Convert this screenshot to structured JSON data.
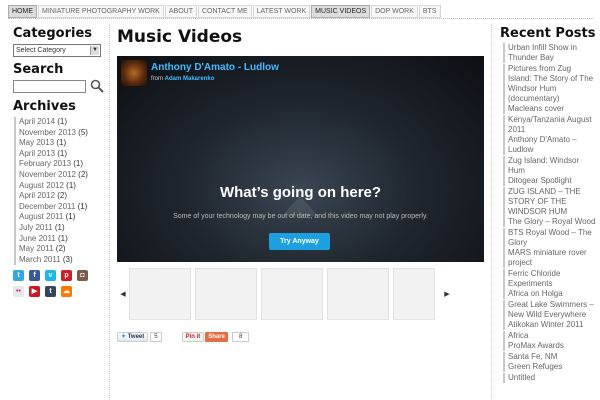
{
  "nav": [
    "HOME",
    "MINIATURE PHOTOGRAPHY WORK",
    "ABOUT",
    "CONTACT ME",
    "LATEST WORK",
    "MUSIC VIDEOS",
    "DOP WORK",
    "BTS"
  ],
  "sidebar": {
    "categories_heading": "Categories",
    "category_select": "Select Category",
    "search_heading": "Search",
    "archives_heading": "Archives",
    "archives": [
      {
        "month": "April 2014",
        "count": "(1)"
      },
      {
        "month": "November 2013",
        "count": "(5)"
      },
      {
        "month": "May 2013",
        "count": "(1)"
      },
      {
        "month": "April 2013",
        "count": "(1)"
      },
      {
        "month": "February 2013",
        "count": "(1)"
      },
      {
        "month": "November 2012",
        "count": "(2)"
      },
      {
        "month": "August 2012",
        "count": "(1)"
      },
      {
        "month": "April 2012",
        "count": "(2)"
      },
      {
        "month": "December 2011",
        "count": "(1)"
      },
      {
        "month": "August 2011",
        "count": "(1)"
      },
      {
        "month": "July 2011",
        "count": "(1)"
      },
      {
        "month": "June 2011",
        "count": "(1)"
      },
      {
        "month": "May 2011",
        "count": "(2)"
      },
      {
        "month": "March 2011",
        "count": "(3)"
      }
    ],
    "social_icons": [
      "twitter-icon",
      "facebook-icon",
      "vimeo-icon",
      "pinterest-icon",
      "instagram-icon",
      "flickr-icon",
      "youtube-icon",
      "tumblr-icon",
      "soundcloud-icon"
    ]
  },
  "main": {
    "page_title": "Music Videos",
    "video": {
      "title": "Anthony D'Amato - Ludlow",
      "from_label": "from",
      "author": "Adam Makarenko",
      "heading": "What’s going on here?",
      "message": "Some of your technology may be out of date, and this video may not play properly.",
      "button": "Try Anyway"
    },
    "share": {
      "tweet_label": "Tweet",
      "tweet_count": "5",
      "pin_label": "Pin it",
      "share_label": "Share",
      "share_count": "8"
    }
  },
  "recent_posts": {
    "heading": "Recent Posts",
    "items": [
      "Urban Infill Show in Thunder Bay",
      "Pictures from Zug Island: The Story of The Windsor Hum (documentary)",
      "Macleans cover",
      "Kenya/Tanzania August 2011",
      "Anthony D'Amato – Ludlow",
      "Zug Island: Windsor Hum",
      "Ditogear Spotlight",
      "ZUG ISLAND – THE STORY OF THE WINDSOR HUM",
      "The Glory – Royal Wood",
      "BTS Royal Wood – The Glory",
      "MARS miniature rover project",
      "Ferric Chloride Experiments",
      "Africa on Holga",
      "Great Lake Swimmers – New Wild Everywhere",
      "Atikokan Winter 2011",
      "Africa",
      "ProMax Awards",
      "Santa Fe, NM",
      "Green Refuges",
      "Untitled"
    ]
  }
}
